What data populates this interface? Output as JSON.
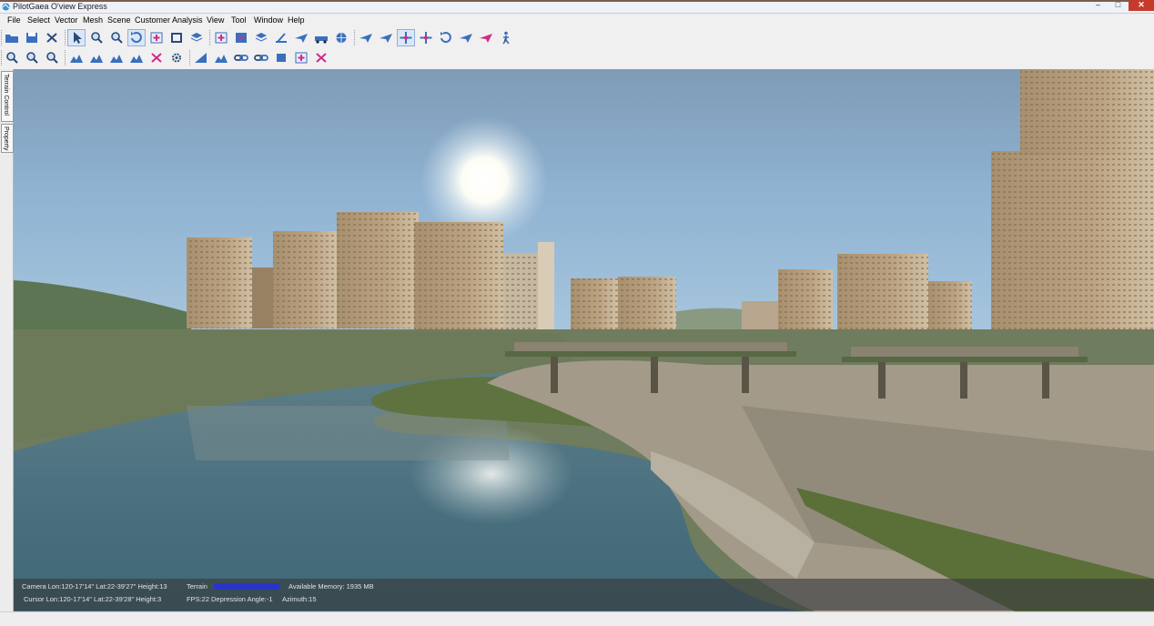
{
  "window": {
    "title": "PilotGaea O'view Express"
  },
  "menu": [
    "File",
    "Select",
    "Vector",
    "Mesh",
    "Scene",
    "Customer",
    "Analysis",
    "View",
    "Tool",
    "Window",
    "Help"
  ],
  "toolbar_row1": [
    "open-folder-icon",
    "save-icon",
    "cut-icon",
    "pointer-icon",
    "lasso-icon",
    "zoom-select-icon",
    "rotate-view-icon",
    "add-point-icon",
    "rectangle-icon",
    "layer-icon",
    "add-layer-icon",
    "remove-layer-icon",
    "terrain-layer-icon",
    "tilt-icon",
    "plane-icon",
    "vehicle-icon",
    "globe-icon",
    "fly-point-icon",
    "fly-path-icon",
    "pan-icon",
    "move-up-icon",
    "rotate-icon",
    "flight-icon",
    "fly-pink-icon",
    "walk-icon"
  ],
  "toolbar_row2": [
    "measure-icon",
    "measure-area-icon",
    "measure-height-icon",
    "terrain-profile-icon",
    "terrain-flatten-icon",
    "terrain-raise-icon",
    "terrain-edit-icon",
    "marker-delete-icon",
    "settings-gear-icon",
    "viewshed-icon",
    "mountain-icon",
    "link-icon",
    "chain-icon",
    "path-edit-icon",
    "path-add-icon",
    "path-delete-icon"
  ],
  "toolbar_pressed": {
    "row1": [
      3,
      6,
      19
    ]
  },
  "dock_tabs": [
    "Terrain Control",
    "Property"
  ],
  "status": {
    "camera": "Camera Lon:120-17'14\" Lat:22-39'27\" Height:13",
    "terrain_label": "Terrain",
    "memory": "Available Memory: 1935 MB",
    "cursor": "Cursor Lon:120-17'14\" Lat:22-39'28\" Height:3",
    "fps": "FPS:22",
    "depression": "Depression Angle:-1",
    "azimuth": "Azimuth:15"
  },
  "colors": {
    "accent": "#3a6fbf",
    "pink": "#d12a86",
    "terrain_bar": "#2736c8",
    "close": "#c63a2c"
  }
}
